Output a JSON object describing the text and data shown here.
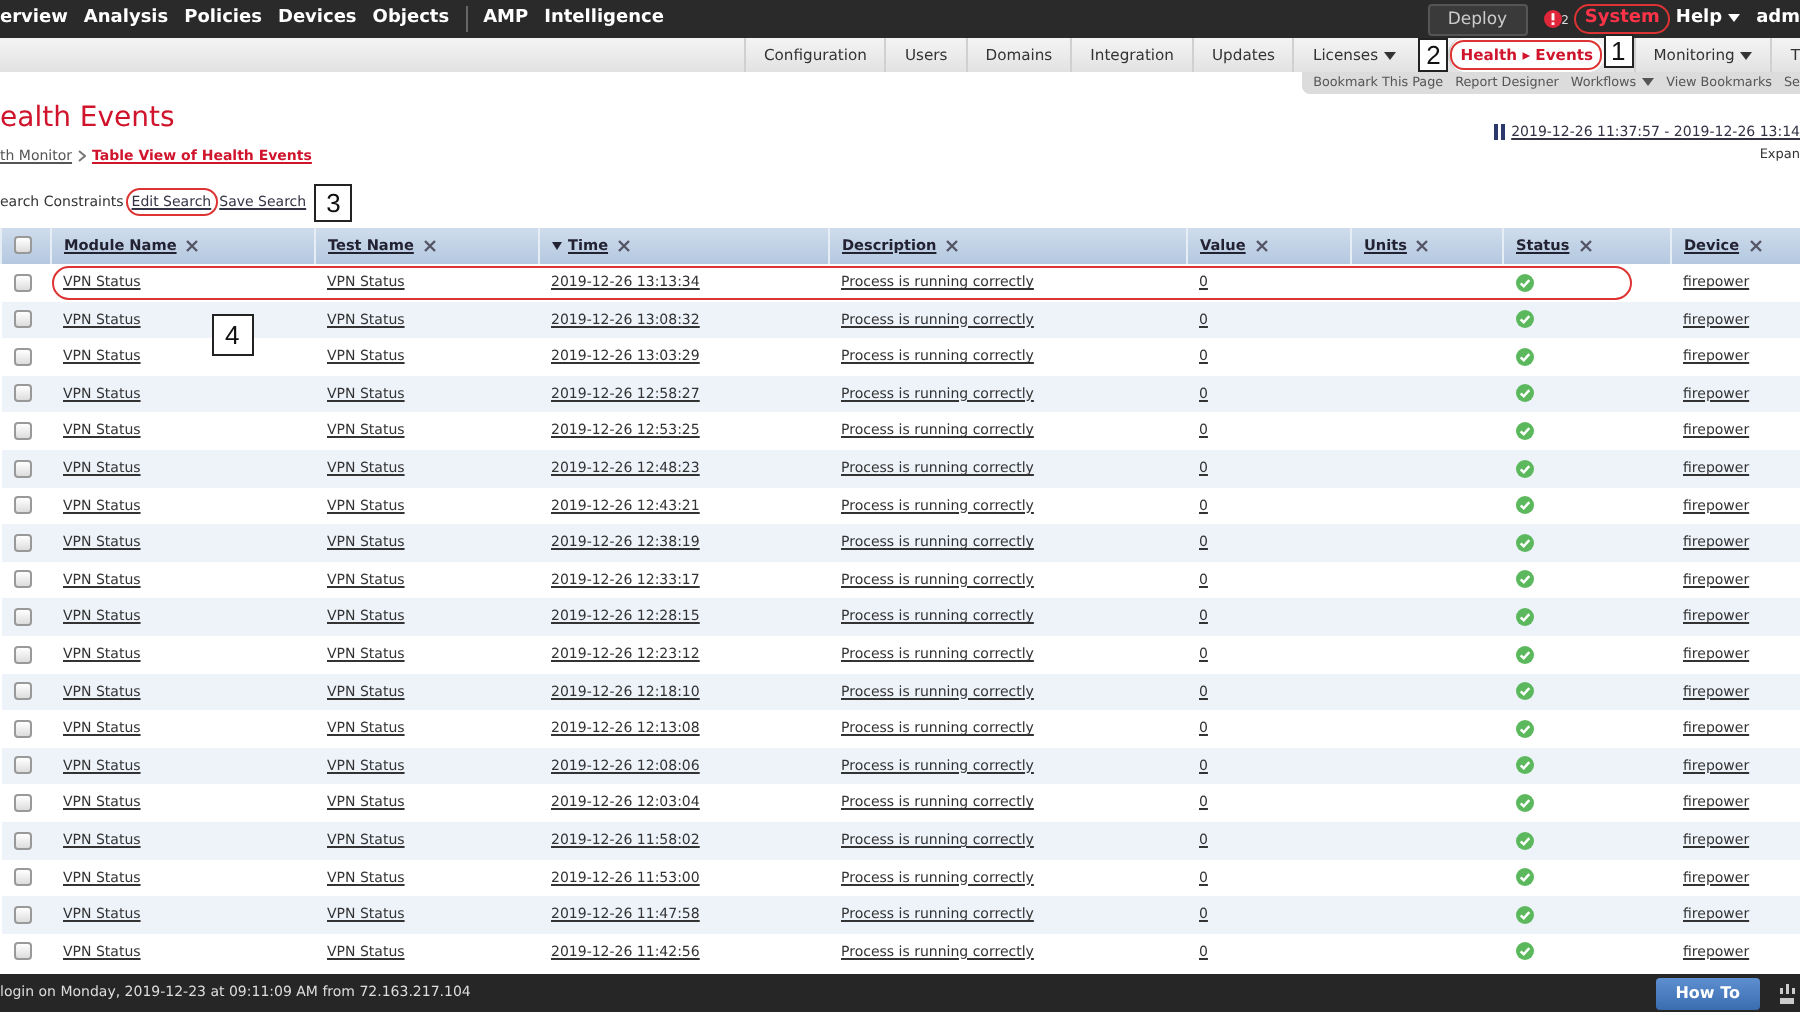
{
  "top_nav": {
    "items": [
      {
        "label": "erview"
      },
      {
        "label": "Analysis"
      },
      {
        "label": "Policies"
      },
      {
        "label": "Devices"
      },
      {
        "label": "Objects"
      },
      {
        "label": "AMP",
        "separator_before": true
      },
      {
        "label": "Intelligence"
      }
    ],
    "deploy": "Deploy",
    "alert_count": "2",
    "right_items": [
      {
        "label": "System",
        "selected": true,
        "circled": true,
        "callout": "1",
        "caret": false
      },
      {
        "label": "Help",
        "selected": false,
        "circled": false,
        "caret": true
      },
      {
        "label": "adm",
        "selected": false,
        "circled": false,
        "caret": false
      }
    ]
  },
  "sub_nav": [
    {
      "label": "Configuration",
      "selected": false,
      "caret": false,
      "circled": false
    },
    {
      "label": "Users",
      "selected": false,
      "caret": false,
      "circled": false
    },
    {
      "label": "Domains",
      "selected": false,
      "caret": false,
      "circled": false
    },
    {
      "label": "Integration",
      "selected": false,
      "caret": false,
      "circled": false
    },
    {
      "label": "Updates",
      "selected": false,
      "caret": false,
      "circled": false
    },
    {
      "label": "Licenses",
      "selected": false,
      "caret": true,
      "circled": false
    },
    {
      "label": "Health ▸ Events",
      "selected": true,
      "caret": false,
      "circled": true,
      "callout": "2"
    },
    {
      "label": "Monitoring",
      "selected": false,
      "caret": true,
      "circled": false
    },
    {
      "label": "T",
      "selected": false,
      "caret": false,
      "circled": false
    }
  ],
  "bookmark_bar": [
    {
      "label": "Bookmark This Page",
      "caret": false
    },
    {
      "label": "Report Designer",
      "caret": false
    },
    {
      "label": "Workflows",
      "caret": true
    },
    {
      "label": "View Bookmarks",
      "caret": false
    },
    {
      "label": "Se",
      "caret": false
    }
  ],
  "page": {
    "title": "ealth Events",
    "breadcrumb": [
      {
        "label": "th Monitor",
        "current": false
      },
      {
        "label": "Table View of Health Events",
        "current": true
      }
    ],
    "time_range": "2019-12-26 11:37:57 - 2019-12-26 13:14",
    "expand": "Expan"
  },
  "search": {
    "label": "earch Constraints",
    "links": [
      {
        "label": "Edit Search",
        "circled": true
      },
      {
        "label": "Save Search",
        "circled": false,
        "callout": "3"
      }
    ]
  },
  "table": {
    "select_all_checked": false,
    "columns": [
      {
        "label": "Module Name"
      },
      {
        "label": "Test Name"
      },
      {
        "label": "Time",
        "sorted": true
      },
      {
        "label": "Description"
      },
      {
        "label": "Value"
      },
      {
        "label": "Units"
      },
      {
        "label": "Status"
      },
      {
        "label": "Device"
      }
    ],
    "rows": [
      {
        "checked": false,
        "circled": true,
        "callout": "4",
        "module": "VPN Status",
        "test": "VPN Status",
        "time": "2019-12-26 13:13:34",
        "description": "Process is running correctly",
        "value": "0",
        "ok": true,
        "device": "firepower"
      },
      {
        "checked": false,
        "circled": false,
        "module": "VPN Status",
        "test": "VPN Status",
        "time": "2019-12-26 13:08:32",
        "description": "Process is running correctly",
        "value": "0",
        "ok": true,
        "device": "firepower"
      },
      {
        "checked": false,
        "circled": false,
        "module": "VPN Status",
        "test": "VPN Status",
        "time": "2019-12-26 13:03:29",
        "description": "Process is running correctly",
        "value": "0",
        "ok": true,
        "device": "firepower"
      },
      {
        "checked": false,
        "circled": false,
        "module": "VPN Status",
        "test": "VPN Status",
        "time": "2019-12-26 12:58:27",
        "description": "Process is running correctly",
        "value": "0",
        "ok": true,
        "device": "firepower"
      },
      {
        "checked": false,
        "circled": false,
        "module": "VPN Status",
        "test": "VPN Status",
        "time": "2019-12-26 12:53:25",
        "description": "Process is running correctly",
        "value": "0",
        "ok": true,
        "device": "firepower"
      },
      {
        "checked": false,
        "circled": false,
        "module": "VPN Status",
        "test": "VPN Status",
        "time": "2019-12-26 12:48:23",
        "description": "Process is running correctly",
        "value": "0",
        "ok": true,
        "device": "firepower"
      },
      {
        "checked": false,
        "circled": false,
        "module": "VPN Status",
        "test": "VPN Status",
        "time": "2019-12-26 12:43:21",
        "description": "Process is running correctly",
        "value": "0",
        "ok": true,
        "device": "firepower"
      },
      {
        "checked": false,
        "circled": false,
        "module": "VPN Status",
        "test": "VPN Status",
        "time": "2019-12-26 12:38:19",
        "description": "Process is running correctly",
        "value": "0",
        "ok": true,
        "device": "firepower"
      },
      {
        "checked": false,
        "circled": false,
        "module": "VPN Status",
        "test": "VPN Status",
        "time": "2019-12-26 12:33:17",
        "description": "Process is running correctly",
        "value": "0",
        "ok": true,
        "device": "firepower"
      },
      {
        "checked": false,
        "circled": false,
        "module": "VPN Status",
        "test": "VPN Status",
        "time": "2019-12-26 12:28:15",
        "description": "Process is running correctly",
        "value": "0",
        "ok": true,
        "device": "firepower"
      },
      {
        "checked": false,
        "circled": false,
        "module": "VPN Status",
        "test": "VPN Status",
        "time": "2019-12-26 12:23:12",
        "description": "Process is running correctly",
        "value": "0",
        "ok": true,
        "device": "firepower"
      },
      {
        "checked": false,
        "circled": false,
        "module": "VPN Status",
        "test": "VPN Status",
        "time": "2019-12-26 12:18:10",
        "description": "Process is running correctly",
        "value": "0",
        "ok": true,
        "device": "firepower"
      },
      {
        "checked": false,
        "circled": false,
        "module": "VPN Status",
        "test": "VPN Status",
        "time": "2019-12-26 12:13:08",
        "description": "Process is running correctly",
        "value": "0",
        "ok": true,
        "device": "firepower"
      },
      {
        "checked": false,
        "circled": false,
        "module": "VPN Status",
        "test": "VPN Status",
        "time": "2019-12-26 12:08:06",
        "description": "Process is running correctly",
        "value": "0",
        "ok": true,
        "device": "firepower"
      },
      {
        "checked": false,
        "circled": false,
        "module": "VPN Status",
        "test": "VPN Status",
        "time": "2019-12-26 12:03:04",
        "description": "Process is running correctly",
        "value": "0",
        "ok": true,
        "device": "firepower"
      },
      {
        "checked": false,
        "circled": false,
        "module": "VPN Status",
        "test": "VPN Status",
        "time": "2019-12-26 11:58:02",
        "description": "Process is running correctly",
        "value": "0",
        "ok": true,
        "device": "firepower"
      },
      {
        "checked": false,
        "circled": false,
        "module": "VPN Status",
        "test": "VPN Status",
        "time": "2019-12-26 11:53:00",
        "description": "Process is running correctly",
        "value": "0",
        "ok": true,
        "device": "firepower"
      },
      {
        "checked": false,
        "circled": false,
        "module": "VPN Status",
        "test": "VPN Status",
        "time": "2019-12-26 11:47:58",
        "description": "Process is running correctly",
        "value": "0",
        "ok": true,
        "device": "firepower"
      },
      {
        "checked": false,
        "circled": false,
        "module": "VPN Status",
        "test": "VPN Status",
        "time": "2019-12-26 11:42:56",
        "description": "Process is running correctly",
        "value": "0",
        "ok": true,
        "device": "firepower"
      }
    ]
  },
  "footer": {
    "login": "login on Monday, 2019-12-23 at 09:11:09 AM from 72.163.217.104",
    "how_to": "How To"
  }
}
